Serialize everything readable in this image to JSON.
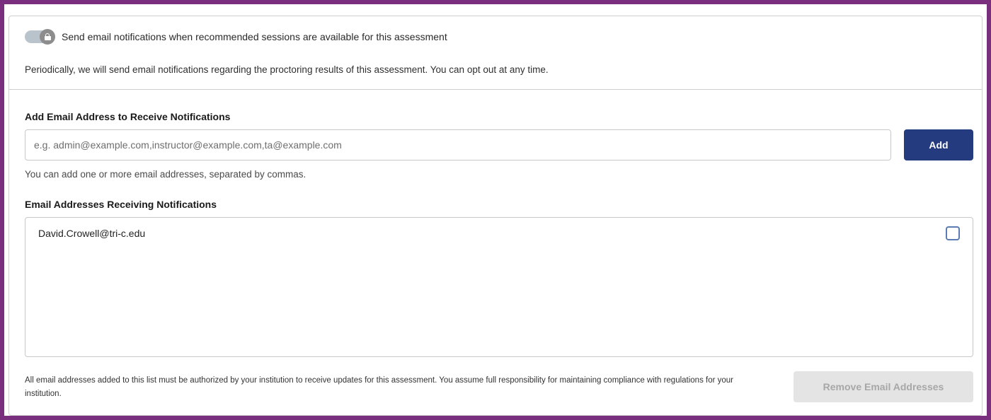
{
  "notifications": {
    "toggle_label": "Send email notifications when recommended sessions are available for this assessment",
    "toggle_state": "on",
    "toggle_locked": true,
    "toggle_icon": "lock-icon",
    "description": "Periodically, we will send email notifications regarding the proctoring results of this assessment. You can opt out at any time."
  },
  "add_email": {
    "title": "Add Email Address to Receive Notifications",
    "placeholder": "e.g. admin@example.com,instructor@example.com,ta@example.com",
    "value": "",
    "add_label": "Add",
    "hint": "You can add one or more email addresses, separated by commas."
  },
  "email_list": {
    "title": "Email Addresses Receiving Notifications",
    "items": [
      {
        "email": "David.Crowell@tri-c.edu",
        "checked": false
      }
    ]
  },
  "footer": {
    "disclaimer": "All email addresses added to this list must be authorized by your institution to receive updates for this assessment. You assume full responsibility for maintaining compliance with regulations for your institution.",
    "remove_label": "Remove Email Addresses"
  },
  "colors": {
    "frame": "#7a2e7e",
    "primary_button": "#243b80",
    "disabled_button": "#e4e4e4",
    "checkbox_border": "#5b7bb5"
  }
}
